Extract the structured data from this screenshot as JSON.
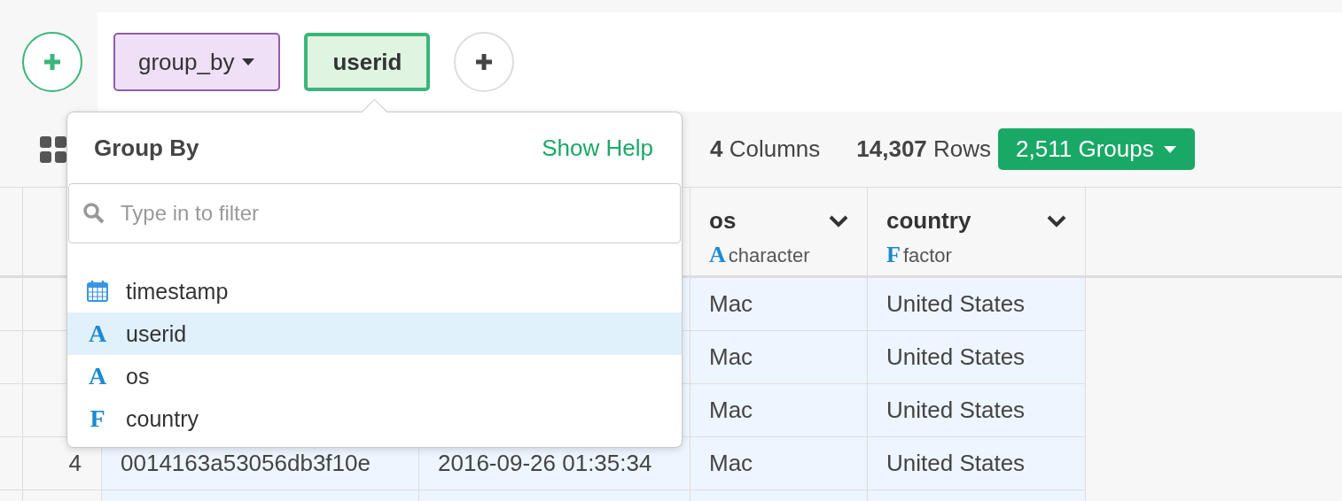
{
  "steps": [
    {
      "label": "group_by",
      "kind": "command",
      "selected": false
    },
    {
      "label": "userid",
      "kind": "argument",
      "selected": true
    }
  ],
  "summary": {
    "columns_count": "4",
    "columns_label": "Columns",
    "rows_count": "14,307",
    "rows_label": "Rows",
    "groups_button": "2,511 Groups"
  },
  "table": {
    "columns": [
      {
        "name": "os",
        "icon": "A",
        "type": "character"
      },
      {
        "name": "country",
        "icon": "F",
        "type": "factor"
      }
    ],
    "rows": [
      {
        "os": "Mac",
        "country": "United States"
      },
      {
        "os": "Mac",
        "country": "United States"
      },
      {
        "os": "Mac",
        "country": "United States"
      },
      {
        "number": "4",
        "userid": "0014163a53056db3f10e",
        "timestamp": "2016-09-26 01:35:34",
        "os": "Mac",
        "country": "United States"
      }
    ]
  },
  "popover": {
    "title": "Group By",
    "help_link": "Show Help",
    "search": {
      "placeholder": "Type in to filter"
    },
    "items": [
      {
        "label": "timestamp",
        "kind": "date",
        "selected": false
      },
      {
        "label": "userid",
        "kind": "character",
        "icon": "A",
        "selected": true
      },
      {
        "label": "os",
        "kind": "character",
        "icon": "A",
        "selected": false
      },
      {
        "label": "country",
        "kind": "factor",
        "icon": "F",
        "selected": false
      }
    ]
  }
}
